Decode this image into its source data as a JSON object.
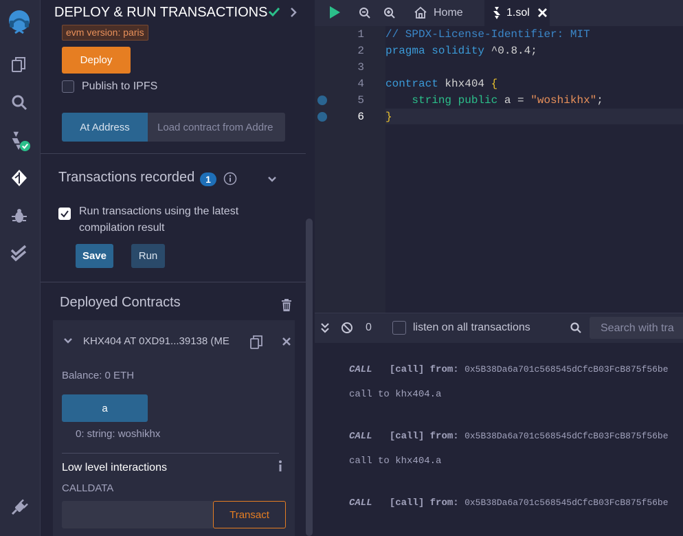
{
  "panel": {
    "title": "DEPLOY & RUN TRANSACTIONS",
    "evm_version": "evm version: paris",
    "deploy_label": "Deploy",
    "publish_ipfs_label": "Publish to IPFS",
    "at_address_label": "At Address",
    "load_contract_placeholder": "Load contract from Addre",
    "transactions_recorded_label": "Transactions recorded",
    "transactions_count": "1",
    "run_latest_label": "Run transactions using the latest",
    "run_latest_label2": "compilation result",
    "save_label": "Save",
    "run_label": "Run",
    "deployed_contracts_label": "Deployed Contracts",
    "contract_title": "KHX404 AT 0XD91...39138 (ME",
    "balance": "Balance: 0 ETH",
    "fn_a_label": "a",
    "fn_a_result": "0: string: woshikhx",
    "low_level_label": "Low level interactions",
    "calldata_label": "CALLDATA",
    "transact_label": "Transact"
  },
  "editor": {
    "tabs": [
      {
        "label": "Home"
      },
      {
        "label": "1.sol"
      }
    ],
    "line_numbers": [
      "1",
      "2",
      "3",
      "4",
      "5",
      "6"
    ],
    "lines": {
      "l1": "// SPDX-License-Identifier: MIT",
      "l2_kw": "pragma solidity",
      "l2_rest": " ^0.8.4;",
      "l4_kw": "contract",
      "l4_name": " khx404 ",
      "l4_brace": "{",
      "l5_type": "string",
      "l5_public": " public",
      "l5_var": " a = ",
      "l5_str": "\"woshikhx\"",
      "l5_semi": ";",
      "l6_brace": "}"
    }
  },
  "terminal": {
    "count": "0",
    "listen_label": "listen on all transactions",
    "search_placeholder": "Search with tra",
    "logs": [
      {
        "type": "CALL",
        "kind": "[call]",
        "from_label": "from:",
        "from": "0x5B38Da6a701c568545dCfcB03FcB875f56be",
        "detail": "call to khx404.a"
      },
      {
        "type": "CALL",
        "kind": "[call]",
        "from_label": "from:",
        "from": "0x5B38Da6a701c568545dCfcB03FcB875f56be",
        "detail": "call to khx404.a"
      },
      {
        "type": "CALL",
        "kind": "[call]",
        "from_label": "from:",
        "from": "0x5B38Da6a701c568545dCfcB03FcB875f56be"
      }
    ]
  },
  "colors": {
    "accent_orange": "#e67e22",
    "accent_blue": "#2a6591",
    "success_green": "#2bbf8a",
    "badge_blue": "#1e6fb8"
  }
}
